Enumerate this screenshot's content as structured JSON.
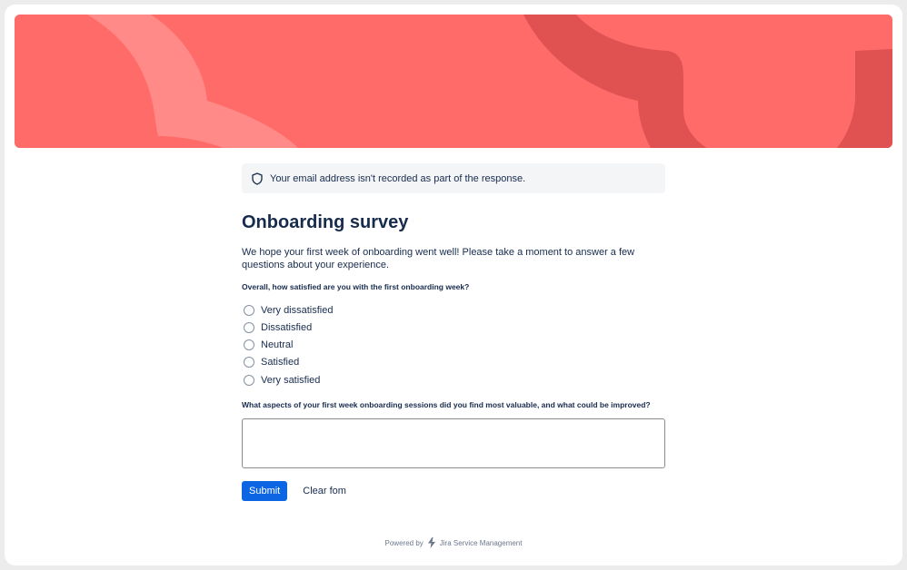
{
  "banner": {
    "background_color": "#ff6b69",
    "accent_light": "#ff8a88",
    "accent_dark": "#e05252"
  },
  "privacy_notice": {
    "icon": "shield-icon",
    "text": "Your email address isn't recorded as part of the response."
  },
  "form": {
    "title": "Onboarding survey",
    "description": "We hope your first week of onboarding went well! Please take a moment to answer a few questions about your experience.",
    "question1": {
      "label": "Overall, how satisfied are you with the first onboarding week?",
      "options": [
        "Very dissatisfied",
        "Dissatisfied",
        "Neutral",
        "Satisfied",
        "Very satisfied"
      ]
    },
    "question2": {
      "label": "What aspects of your first week onboarding sessions did you find most valuable, and what could be improved?",
      "value": ""
    },
    "submit_label": "Submit",
    "clear_label": "Clear fom"
  },
  "footer": {
    "powered_by": "Powered by",
    "product_icon": "jira-bolt-icon",
    "product": "Jira Service Management"
  },
  "colors": {
    "primary": "#0c66e4",
    "text": "#172b4d",
    "muted": "#6b778c"
  }
}
